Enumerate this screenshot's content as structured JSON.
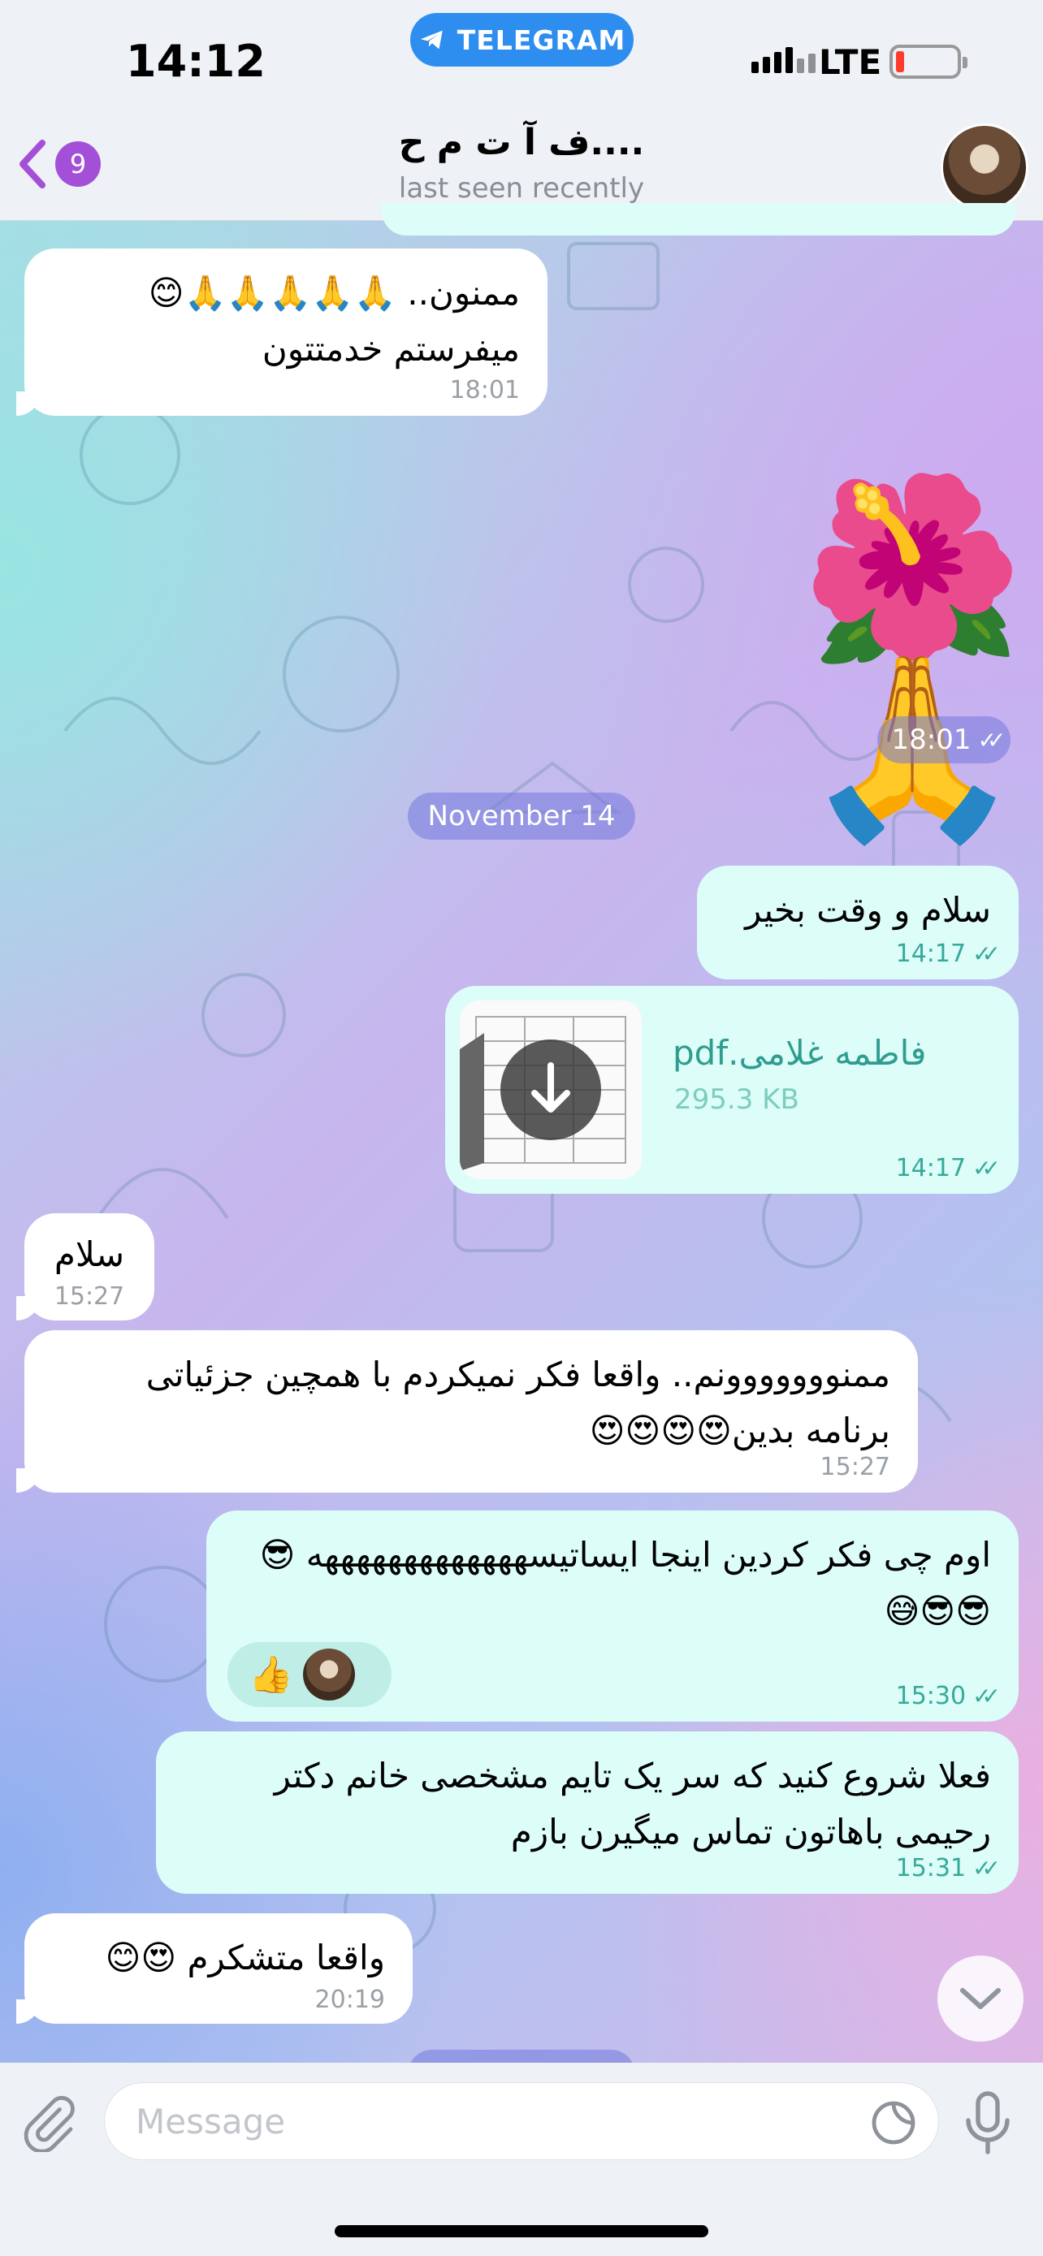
{
  "status_bar": {
    "time": "14:12",
    "app_pill": "TELEGRAM",
    "network": "LTE"
  },
  "header": {
    "back_count": "9",
    "title": "ف آ ت م ح....",
    "subtitle": "last seen recently"
  },
  "messages": [
    {
      "text": "ممنون.. 🙏🙏🙏🙏🙏😊\nمیفرستم خدمتتون",
      "time": "18:01"
    },
    {
      "emoji": "🌺🙏",
      "time": "18:01"
    },
    {
      "text": "سلام و وقت بخیر",
      "time": "14:17"
    },
    {
      "file_name": "فاطمه غلامی.pdf",
      "file_size": "295.3 KB",
      "time": "14:17"
    },
    {
      "text": "سلام",
      "time": "15:27"
    },
    {
      "text": "ممنووووووونم.. واقعا فکر نمیکردم با همچین جزئیاتی برنامه بدین😍😍😍😍",
      "time": "15:27"
    },
    {
      "text": "اوم چی فکر کردین اینجا ایساتیسهههههههههههههه 😎😎😎😅",
      "time": "15:30",
      "reaction": "👍"
    },
    {
      "text": "فعلا شروع کنید که سر یک تایم مشخصی خانم دکتر رحیمی باهاتون تماس میگیرن بازم",
      "time": "15:31"
    },
    {
      "text": "واقعا متشکرم 😍😊",
      "time": "20:19"
    }
  ],
  "date_separator": "November 14",
  "composer": {
    "placeholder": "Message"
  },
  "colors": {
    "accent": "#2d8ef0",
    "badge": "#a44fd8",
    "outgoing_bubble": "#dcfdf8",
    "outgoing_meta": "#37a99a"
  }
}
